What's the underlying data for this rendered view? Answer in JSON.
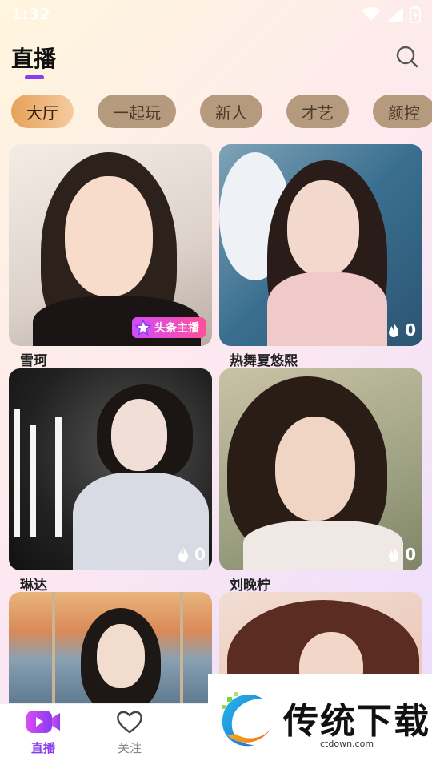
{
  "status": {
    "time": "1:32"
  },
  "header": {
    "title": "直播"
  },
  "tabs": [
    "大厅",
    "一起玩",
    "新人",
    "才艺",
    "颜控"
  ],
  "cards": [
    {
      "name": "雪珂",
      "badge": "头条主播"
    },
    {
      "name": "热舞夏悠熙",
      "viewers": "0"
    },
    {
      "name": "琳达",
      "viewers": "0"
    },
    {
      "name": "刘晚柠",
      "viewers": "0"
    },
    {
      "name": "",
      "viewers": ""
    },
    {
      "name": "",
      "viewers": ""
    }
  ],
  "nav": [
    {
      "label": "直播",
      "icon": "video-icon",
      "active": true
    },
    {
      "label": "关注",
      "icon": "heart-icon",
      "active": false
    }
  ],
  "watermark": {
    "title": "传统下载",
    "url": "ctdown.com"
  },
  "colors": {
    "accent": "#8a3cf0",
    "tab_active": "#e6a25a",
    "tab_inactive": "#b69a7e"
  }
}
